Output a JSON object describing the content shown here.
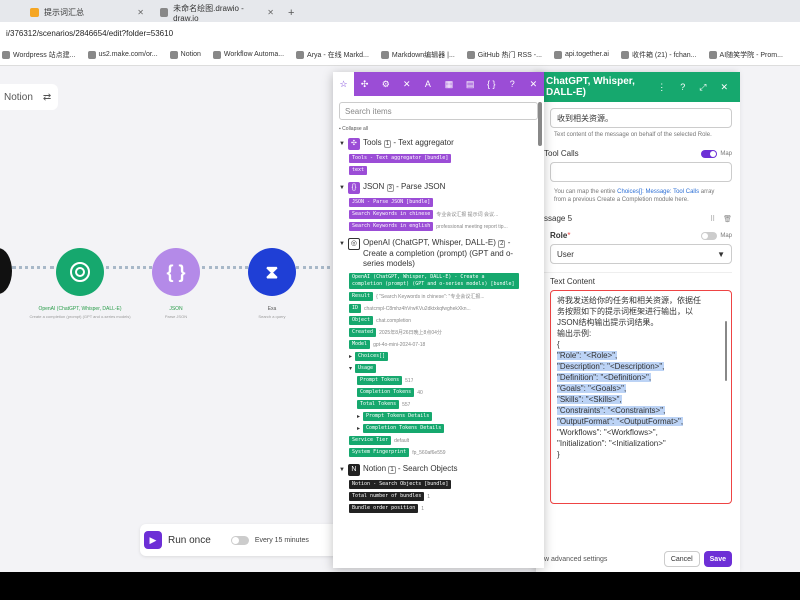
{
  "browser": {
    "tabs": [
      {
        "label": "提示词汇总",
        "active": false,
        "fav": "#f5a623"
      },
      {
        "label": "未命名绘图.drawio - draw.io",
        "active": false,
        "fav": "#888888"
      }
    ],
    "new_tab": "+",
    "url": "i/376312/scenarios/2846654/edit?folder=53610",
    "bookmarks": [
      "Wordpress 站点建...",
      "us2.make.com/or...",
      "Notion",
      "Workflow Automa...",
      "Arya - 在线 Markd...",
      "Markdown编辑器 |...",
      "GitHub 热门 RSS -...",
      "api.together.ai",
      "收件箱 (21) - fchan...",
      "AI随笑学院 - Prom..."
    ]
  },
  "canvas": {
    "notion_tab": "Notion",
    "nodes": [
      {
        "label": "OpenAI (ChatGPT, Whisper, DALL-E)",
        "sub": "Create a completion (prompt) (GPT and o-series models)"
      },
      {
        "label": "JSON",
        "sub": "Parse JSON"
      },
      {
        "label": "Exa",
        "sub": "Search a query"
      }
    ],
    "run_once": "Run once",
    "every": "Every 15 minutes"
  },
  "config_panel": {
    "title": "ChatGPT, Whisper, DALL-E)",
    "prev_text": "收到相关资源。",
    "hint_text": "Text content of the message on behalf of the selected Role.",
    "tool_calls_label": "Tool Calls",
    "map_label": "Map",
    "tool_calls_hint_pre": "You can map the entire ",
    "tool_calls_hint_link": "Choices[]: Message: Tool Calls",
    "tool_calls_hint_post": " array from a previous Create a Completion module here.",
    "message_label": "ssage 5",
    "role_label": "Role",
    "role_value": "User",
    "text_content_label": "Text Content",
    "text_lines": [
      {
        "text": "将我发送给你的任务和相关资源，依据任",
        "hl": false
      },
      {
        "text": "务按照如下的提示词框架进行输出，以",
        "hl": false
      },
      {
        "text": "JSON结构输出提示词结果。",
        "hl": false
      },
      {
        "text": "输出示例:",
        "hl": false
      },
      {
        "text": "{",
        "hl": false
      },
      {
        "text": "    \"Role\": \"<Role>\",",
        "hl": true
      },
      {
        "text": "    \"Description\": \"<Description>\",",
        "hl": true
      },
      {
        "text": "    \"Definition\": \"<Definition>\",",
        "hl": true
      },
      {
        "text": "    \"Goals\": \"<Goals>\",",
        "hl": true
      },
      {
        "text": "    \"Skills\": \"<Skills>\",",
        "hl": true
      },
      {
        "text": "    \"Constraints\": \"<Constraints>\",",
        "hl": true
      },
      {
        "text": "    \"OutputFormat\": \"<OutputFormat>\",",
        "hl": true
      },
      {
        "text": "    \"Workflows\": \"<Workflows>\",",
        "hl": false
      },
      {
        "text": "    \"Initialization\": \"<Initialization>\"",
        "hl": false
      },
      {
        "text": "}",
        "hl": false
      }
    ],
    "adv_settings": "w advanced settings",
    "cancel": "Cancel",
    "save": "Save"
  },
  "mapping_popup": {
    "search_placeholder": "Search items",
    "collapse_all": "Collapse all",
    "groups": [
      {
        "name": "Tools",
        "num": "1",
        "desc": "- Text aggregator",
        "color": "#9b4dd6",
        "icon": "tools-icon",
        "items": [
          {
            "chip": "Tools - Text aggregator [bundle]",
            "chip_color": "purple",
            "val": ""
          },
          {
            "chip": "text",
            "chip_color": "purple",
            "val": ""
          }
        ]
      },
      {
        "name": "JSON",
        "num": "3",
        "desc": "- Parse JSON",
        "color": "#9b4dd6",
        "icon": "json-icon",
        "items": [
          {
            "chip": "JSON - Parse JSON [bundle]",
            "chip_color": "purple",
            "val": ""
          },
          {
            "chip": "Search Keywords in chinese",
            "chip_color": "purple",
            "val": "专业会议汇报 提示词 会议..."
          },
          {
            "chip": "Search Keywords in english",
            "chip_color": "purple",
            "val": "professional meeting report tip..."
          }
        ]
      },
      {
        "name": "OpenAI (ChatGPT, Whisper, DALL-E)",
        "num": "2",
        "desc": "- Create a completion (prompt) (GPT and o-series models)",
        "color": "#ffffff",
        "icon": "openai-icon",
        "items": [
          {
            "chip": "OpenAI (ChatGPT, Whisper, DALL-E) - Create a completion (prompt) (GPT and o-series models) [bundle]",
            "chip_color": "green",
            "val": ""
          },
          {
            "chip": "Result",
            "chip_color": "green",
            "val": "{ \"Search Keywords in chinese\": \"专业会议汇报..."
          },
          {
            "chip": "ID",
            "chip_color": "green",
            "val": "chatcmpl-C8mhz4hVrwKVu2dktxkqfwghekXkn..."
          },
          {
            "chip": "Object",
            "chip_color": "green",
            "val": "chat.completion"
          },
          {
            "chip": "Created",
            "chip_color": "green",
            "val": "2025年8月26日晚上8点04分"
          },
          {
            "chip": "Model",
            "chip_color": "green",
            "val": "gpt-4o-mini-2024-07-18"
          },
          {
            "chip": "Choices[]",
            "chip_color": "green",
            "val": "",
            "tri": true
          },
          {
            "chip": "Usage",
            "chip_color": "green",
            "val": "",
            "tri_open": true
          },
          {
            "chip": "Prompt Tokens",
            "chip_color": "green",
            "val": "517",
            "indent": true
          },
          {
            "chip": "Completion Tokens",
            "chip_color": "green",
            "val": "40",
            "indent": true
          },
          {
            "chip": "Total Tokens",
            "chip_color": "green",
            "val": "557",
            "indent": true
          },
          {
            "chip": "Prompt Tokens Details",
            "chip_color": "green",
            "val": "",
            "indent": true,
            "tri": true
          },
          {
            "chip": "Completion Tokens Details",
            "chip_color": "green",
            "val": "",
            "indent": true,
            "tri": true
          },
          {
            "chip": "Service Tier",
            "chip_color": "green",
            "val": "default"
          },
          {
            "chip": "System Fingerprint",
            "chip_color": "green",
            "val": "fp_560af6e559"
          }
        ]
      },
      {
        "name": "Notion",
        "num": "1",
        "desc": "- Search Objects",
        "color": "#222222",
        "icon": "notion-icon",
        "items": [
          {
            "chip": "Notion - Search Objects [bundle]",
            "chip_color": "black",
            "val": ""
          },
          {
            "chip": "Total number of bundles",
            "chip_color": "black",
            "val": "1"
          },
          {
            "chip": "Bundle order position",
            "chip_color": "black",
            "val": "1"
          }
        ]
      }
    ]
  }
}
